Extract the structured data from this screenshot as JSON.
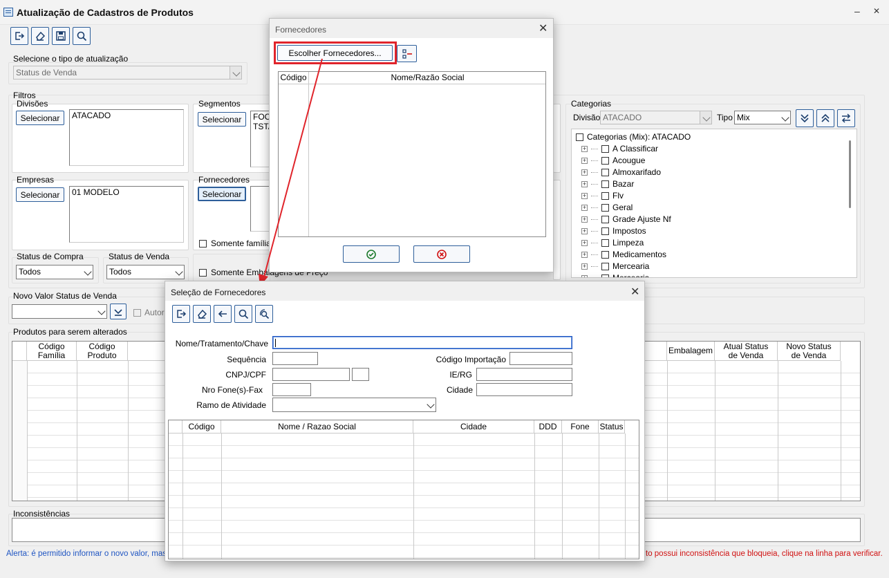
{
  "window": {
    "title": "Atualização de Cadastros de Produtos",
    "minimize": "–",
    "close": "✕"
  },
  "update_type": {
    "legend": "Selecione o tipo de atualização",
    "value": "Status de Venda"
  },
  "filters": {
    "legend": "Filtros",
    "divisoes": {
      "legend": "Divisões",
      "button": "Selecionar",
      "items": [
        "ATACADO"
      ]
    },
    "segmentos": {
      "legend": "Segmentos",
      "button": "Selecionar",
      "items": [
        "FOCO",
        "TSTA"
      ]
    },
    "empresas": {
      "legend": "Empresas",
      "button": "Selecionar",
      "items": [
        "01 MODELO"
      ]
    },
    "fornecedores": {
      "legend": "Fornecedores",
      "button": "Selecionar"
    },
    "somente_familias": "Somente famílias",
    "somente_embalagens": "Somente Embalagens de Preço",
    "status_compra": {
      "legend": "Status de Compra",
      "value": "Todos"
    },
    "status_venda": {
      "legend": "Status de Venda",
      "value": "Todos"
    }
  },
  "categorias": {
    "legend": "Categorias",
    "divisao_label": "Divisão",
    "divisao_value": "ATACADO",
    "tipo_label": "Tipo",
    "tipo_value": "Mix",
    "root": "Categorias (Mix): ATACADO",
    "items": [
      "A Classificar",
      "Acougue",
      "Almoxarifado",
      "Bazar",
      "Flv",
      "Geral",
      "Grade Ajuste Nf",
      "Impostos",
      "Limpeza",
      "Medicamentos",
      "Mercearia",
      "Mercearia"
    ]
  },
  "novo_valor": {
    "legend": "Novo Valor Status de Venda",
    "value": "",
    "autorizar": "Autori"
  },
  "produtos": {
    "legend": "Produtos para serem alterados",
    "headers_left": [
      "Código\nFamília",
      "Código\nProduto"
    ],
    "headers_right": [
      "Embalagem",
      "Atual Status\nde Venda",
      "Novo Status\nde Venda"
    ]
  },
  "inconsistencias": {
    "legend": "Inconsistências"
  },
  "alert_left": "Alerta: é permitido informar o novo valor, mas po",
  "alert_right": "to possui inconsistência que bloqueia, clique na linha para verificar.",
  "dlg_fornecedores": {
    "title": "Fornecedores",
    "close": "✕",
    "choose_button": "Escolher Fornecedores...",
    "headers": [
      "Código",
      "Nome/Razão Social"
    ]
  },
  "dlg_selecao": {
    "title": "Seleção de Fornecedores",
    "close": "✕",
    "labels": {
      "nome": "Nome/Tratamento/Chave",
      "sequencia": "Sequência",
      "codigo_importacao": "Código Importação",
      "cnpj": "CNPJ/CPF",
      "ie_rg": "IE/RG",
      "fone": "Nro Fone(s)-Fax",
      "cidade": "Cidade",
      "ramo": "Ramo de Atividade"
    },
    "headers": [
      "Código",
      "Nome / Razao Social",
      "Cidade",
      "DDD",
      "Fone",
      "Status"
    ]
  },
  "colors": {
    "accent": "#2d5e9a",
    "highlight": "#e0242b",
    "alert_blue": "#1f55c2",
    "alert_red": "#d01010"
  }
}
